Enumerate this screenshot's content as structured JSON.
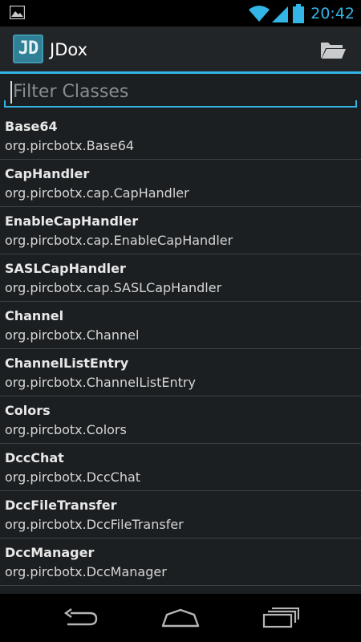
{
  "status_bar": {
    "time": "20:42",
    "left_icon": "image-notification-icon",
    "icons": [
      "wifi-icon",
      "signal-icon",
      "battery-icon"
    ],
    "accent_color": "#33b5e5"
  },
  "action_bar": {
    "logo_text": "JD",
    "title": "JDox",
    "folder_icon": "folder-open-icon"
  },
  "filter": {
    "placeholder": "Filter Classes",
    "value": ""
  },
  "classes": [
    {
      "name": "Base64",
      "fqn": "org.pircbotx.Base64"
    },
    {
      "name": "CapHandler",
      "fqn": "org.pircbotx.cap.CapHandler"
    },
    {
      "name": "EnableCapHandler",
      "fqn": "org.pircbotx.cap.EnableCapHandler"
    },
    {
      "name": "SASLCapHandler",
      "fqn": "org.pircbotx.cap.SASLCapHandler"
    },
    {
      "name": "Channel",
      "fqn": "org.pircbotx.Channel"
    },
    {
      "name": "ChannelListEntry",
      "fqn": "org.pircbotx.ChannelListEntry"
    },
    {
      "name": "Colors",
      "fqn": "org.pircbotx.Colors"
    },
    {
      "name": "DccChat",
      "fqn": "org.pircbotx.DccChat"
    },
    {
      "name": "DccFileTransfer",
      "fqn": "org.pircbotx.DccFileTransfer"
    },
    {
      "name": "DccManager",
      "fqn": "org.pircbotx.DccManager"
    },
    {
      "name": "",
      "fqn": ""
    }
  ],
  "nav_bar": {
    "buttons": [
      "back-icon",
      "home-icon",
      "recent-apps-icon"
    ]
  }
}
